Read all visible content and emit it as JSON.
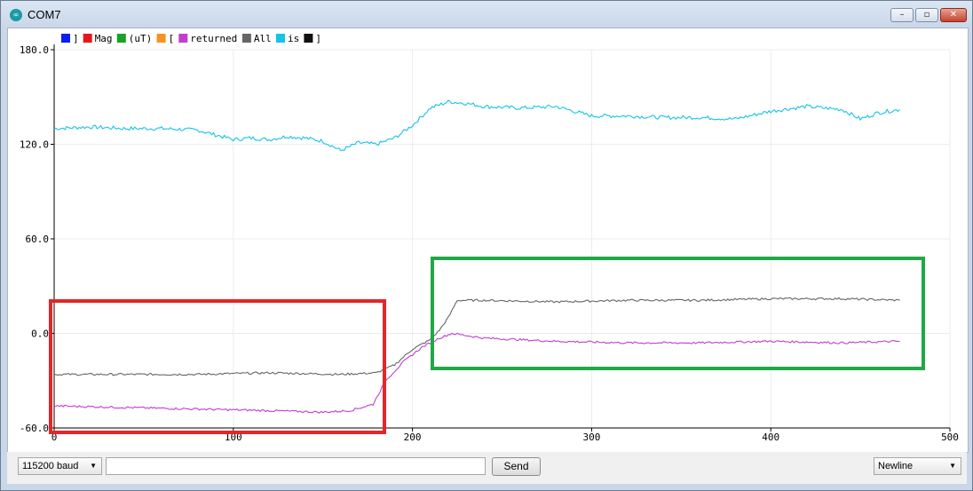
{
  "window": {
    "title": "COM7",
    "icon": "arduino-icon"
  },
  "controls": {
    "minimize": "–",
    "maximize": "▫",
    "close": "✕"
  },
  "legend": [
    {
      "label": "]",
      "color": "#0a1ef0"
    },
    {
      "label": "Mag",
      "color": "#e6161b"
    },
    {
      "label": "(uT)",
      "color": "#17a326"
    },
    {
      "label": "[",
      "color": "#f7941d"
    },
    {
      "label": "returned",
      "color": "#c03fcf"
    },
    {
      "label": "All",
      "color": "#666666"
    },
    {
      "label": "is",
      "color": "#16c4e6"
    },
    {
      "label": "]",
      "color": "#111111"
    }
  ],
  "chart_data": {
    "type": "line",
    "xlim": [
      0,
      500
    ],
    "ylim": [
      -60,
      180
    ],
    "x_ticks": [
      "0",
      "100",
      "200",
      "300",
      "400",
      "500"
    ],
    "y_ticks": [
      "-60.0",
      "0.0",
      "60.0",
      "120.0",
      "180.0"
    ],
    "grid": true,
    "legend_position": "top-left",
    "series": [
      {
        "name": "is",
        "color": "#16c4e6",
        "x": [
          0,
          20,
          40,
          60,
          80,
          100,
          110,
          120,
          130,
          140,
          150,
          160,
          170,
          180,
          190,
          200,
          210,
          220,
          230,
          240,
          260,
          280,
          300,
          320,
          340,
          360,
          380,
          400,
          420,
          440,
          450,
          460,
          472
        ],
        "y": [
          130,
          131,
          130,
          130,
          129,
          123,
          124,
          123,
          125,
          124,
          122,
          116,
          121,
          120,
          124,
          132,
          143,
          147,
          146,
          144,
          143,
          144,
          138,
          138,
          137,
          137,
          136,
          141,
          144,
          142,
          136,
          140,
          142
        ]
      },
      {
        "name": "All",
        "color": "#666666",
        "x": [
          0,
          40,
          80,
          120,
          160,
          180,
          190,
          200,
          210,
          215,
          220,
          225,
          240,
          280,
          320,
          360,
          400,
          440,
          472
        ],
        "y": [
          -26,
          -26,
          -26,
          -25,
          -26,
          -25,
          -20,
          -10,
          -4,
          2,
          10,
          21,
          21,
          20,
          21,
          21,
          22,
          22,
          21
        ]
      },
      {
        "name": "returned",
        "color": "#c03fcf",
        "x": [
          0,
          40,
          80,
          120,
          150,
          165,
          178,
          185,
          195,
          205,
          215,
          222,
          240,
          280,
          320,
          360,
          400,
          440,
          472
        ],
        "y": [
          -46,
          -47,
          -48,
          -49,
          -50,
          -49,
          -45,
          -30,
          -18,
          -9,
          -3,
          0,
          -3,
          -5,
          -6,
          -6,
          -5,
          -6,
          -5
        ]
      }
    ]
  },
  "annotations": [
    {
      "color": "#e3262a"
    },
    {
      "color": "#20a846"
    }
  ],
  "bottom": {
    "baud": "115200 baud",
    "input_value": "",
    "send_label": "Send",
    "line_ending": "Newline"
  }
}
